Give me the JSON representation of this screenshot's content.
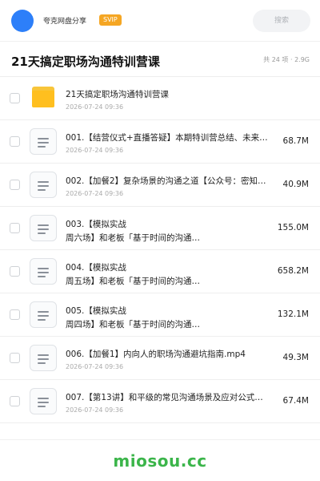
{
  "header": {
    "user_name": "夸克网盘分享",
    "badge": "SVIP",
    "search_placeholder": "搜索"
  },
  "title_bar": {
    "title": "21天搞定职场沟通特训营课",
    "summary": "共 24 项 · 2.9G"
  },
  "items": [
    {
      "type": "folder",
      "name": "21天搞定职场沟通特训营课",
      "date": "2026-07-24 09:36",
      "size": ""
    },
    {
      "type": "file",
      "name": "001.【结营仪式+直播答疑】本期特训营总结、未来…",
      "date": "2026-07-24 09:36",
      "size": "68.7M"
    },
    {
      "type": "file",
      "name": "002.【加餐2】复杂场景的沟通之道【公众号：密知…",
      "date": "2026-07-24 09:36",
      "size": "40.9M"
    },
    {
      "type": "file",
      "name": "003.【模拟实战\n周六场】和老板「基于时间的沟通…",
      "date": "",
      "size": "155.0M"
    },
    {
      "type": "file",
      "name": "004.【模拟实战\n周五场】和老板「基于时间的沟通…",
      "date": "",
      "size": "658.2M"
    },
    {
      "type": "file",
      "name": "005.【模拟实战\n周四场】和老板「基于时间的沟通…",
      "date": "",
      "size": "132.1M"
    },
    {
      "type": "file",
      "name": "006.【加餐1】内向人的职场沟通避坑指南.mp4",
      "date": "2026-07-24 09:36",
      "size": "49.3M"
    },
    {
      "type": "file",
      "name": "007.【第13讲】和平级的常见沟通场景及应对公式…",
      "date": "2026-07-24 09:36",
      "size": "67.4M"
    }
  ],
  "footer": {
    "watermark": "miosou.cc"
  },
  "colors": {
    "avatar": "#2d7ff9",
    "badge": "#f5a623",
    "folder": "#ffbf1f",
    "watermark": "#3bb54a"
  }
}
